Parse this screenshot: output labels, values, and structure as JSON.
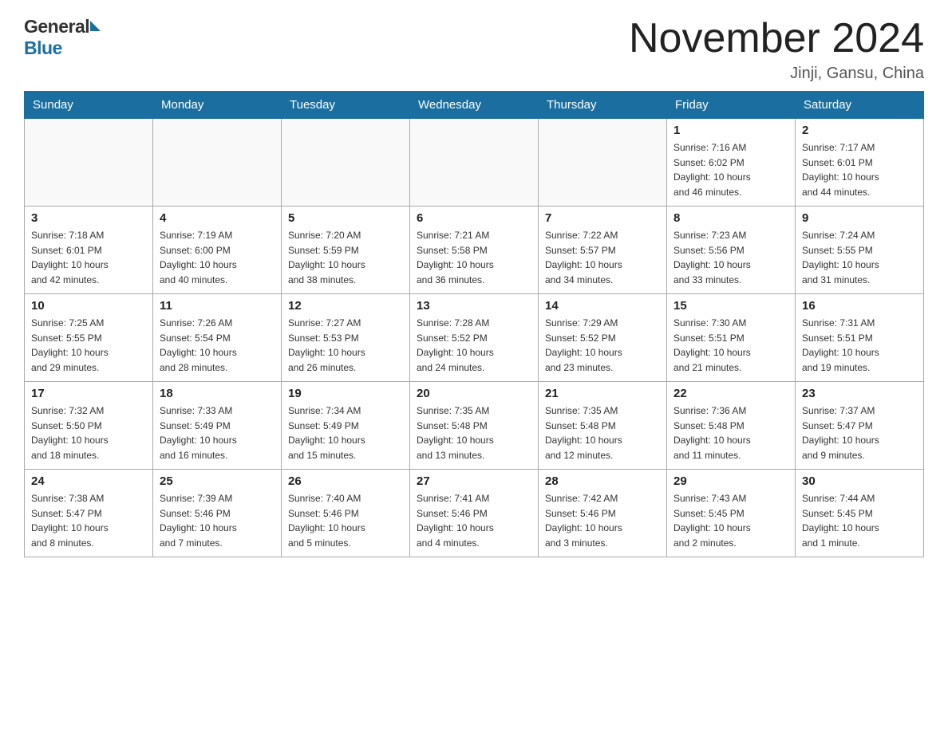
{
  "header": {
    "month_title": "November 2024",
    "location": "Jinji, Gansu, China",
    "logo_general": "General",
    "logo_blue": "Blue"
  },
  "weekdays": [
    "Sunday",
    "Monday",
    "Tuesday",
    "Wednesday",
    "Thursday",
    "Friday",
    "Saturday"
  ],
  "weeks": [
    [
      {
        "day": "",
        "info": ""
      },
      {
        "day": "",
        "info": ""
      },
      {
        "day": "",
        "info": ""
      },
      {
        "day": "",
        "info": ""
      },
      {
        "day": "",
        "info": ""
      },
      {
        "day": "1",
        "info": "Sunrise: 7:16 AM\nSunset: 6:02 PM\nDaylight: 10 hours\nand 46 minutes."
      },
      {
        "day": "2",
        "info": "Sunrise: 7:17 AM\nSunset: 6:01 PM\nDaylight: 10 hours\nand 44 minutes."
      }
    ],
    [
      {
        "day": "3",
        "info": "Sunrise: 7:18 AM\nSunset: 6:01 PM\nDaylight: 10 hours\nand 42 minutes."
      },
      {
        "day": "4",
        "info": "Sunrise: 7:19 AM\nSunset: 6:00 PM\nDaylight: 10 hours\nand 40 minutes."
      },
      {
        "day": "5",
        "info": "Sunrise: 7:20 AM\nSunset: 5:59 PM\nDaylight: 10 hours\nand 38 minutes."
      },
      {
        "day": "6",
        "info": "Sunrise: 7:21 AM\nSunset: 5:58 PM\nDaylight: 10 hours\nand 36 minutes."
      },
      {
        "day": "7",
        "info": "Sunrise: 7:22 AM\nSunset: 5:57 PM\nDaylight: 10 hours\nand 34 minutes."
      },
      {
        "day": "8",
        "info": "Sunrise: 7:23 AM\nSunset: 5:56 PM\nDaylight: 10 hours\nand 33 minutes."
      },
      {
        "day": "9",
        "info": "Sunrise: 7:24 AM\nSunset: 5:55 PM\nDaylight: 10 hours\nand 31 minutes."
      }
    ],
    [
      {
        "day": "10",
        "info": "Sunrise: 7:25 AM\nSunset: 5:55 PM\nDaylight: 10 hours\nand 29 minutes."
      },
      {
        "day": "11",
        "info": "Sunrise: 7:26 AM\nSunset: 5:54 PM\nDaylight: 10 hours\nand 28 minutes."
      },
      {
        "day": "12",
        "info": "Sunrise: 7:27 AM\nSunset: 5:53 PM\nDaylight: 10 hours\nand 26 minutes."
      },
      {
        "day": "13",
        "info": "Sunrise: 7:28 AM\nSunset: 5:52 PM\nDaylight: 10 hours\nand 24 minutes."
      },
      {
        "day": "14",
        "info": "Sunrise: 7:29 AM\nSunset: 5:52 PM\nDaylight: 10 hours\nand 23 minutes."
      },
      {
        "day": "15",
        "info": "Sunrise: 7:30 AM\nSunset: 5:51 PM\nDaylight: 10 hours\nand 21 minutes."
      },
      {
        "day": "16",
        "info": "Sunrise: 7:31 AM\nSunset: 5:51 PM\nDaylight: 10 hours\nand 19 minutes."
      }
    ],
    [
      {
        "day": "17",
        "info": "Sunrise: 7:32 AM\nSunset: 5:50 PM\nDaylight: 10 hours\nand 18 minutes."
      },
      {
        "day": "18",
        "info": "Sunrise: 7:33 AM\nSunset: 5:49 PM\nDaylight: 10 hours\nand 16 minutes."
      },
      {
        "day": "19",
        "info": "Sunrise: 7:34 AM\nSunset: 5:49 PM\nDaylight: 10 hours\nand 15 minutes."
      },
      {
        "day": "20",
        "info": "Sunrise: 7:35 AM\nSunset: 5:48 PM\nDaylight: 10 hours\nand 13 minutes."
      },
      {
        "day": "21",
        "info": "Sunrise: 7:35 AM\nSunset: 5:48 PM\nDaylight: 10 hours\nand 12 minutes."
      },
      {
        "day": "22",
        "info": "Sunrise: 7:36 AM\nSunset: 5:48 PM\nDaylight: 10 hours\nand 11 minutes."
      },
      {
        "day": "23",
        "info": "Sunrise: 7:37 AM\nSunset: 5:47 PM\nDaylight: 10 hours\nand 9 minutes."
      }
    ],
    [
      {
        "day": "24",
        "info": "Sunrise: 7:38 AM\nSunset: 5:47 PM\nDaylight: 10 hours\nand 8 minutes."
      },
      {
        "day": "25",
        "info": "Sunrise: 7:39 AM\nSunset: 5:46 PM\nDaylight: 10 hours\nand 7 minutes."
      },
      {
        "day": "26",
        "info": "Sunrise: 7:40 AM\nSunset: 5:46 PM\nDaylight: 10 hours\nand 5 minutes."
      },
      {
        "day": "27",
        "info": "Sunrise: 7:41 AM\nSunset: 5:46 PM\nDaylight: 10 hours\nand 4 minutes."
      },
      {
        "day": "28",
        "info": "Sunrise: 7:42 AM\nSunset: 5:46 PM\nDaylight: 10 hours\nand 3 minutes."
      },
      {
        "day": "29",
        "info": "Sunrise: 7:43 AM\nSunset: 5:45 PM\nDaylight: 10 hours\nand 2 minutes."
      },
      {
        "day": "30",
        "info": "Sunrise: 7:44 AM\nSunset: 5:45 PM\nDaylight: 10 hours\nand 1 minute."
      }
    ]
  ]
}
